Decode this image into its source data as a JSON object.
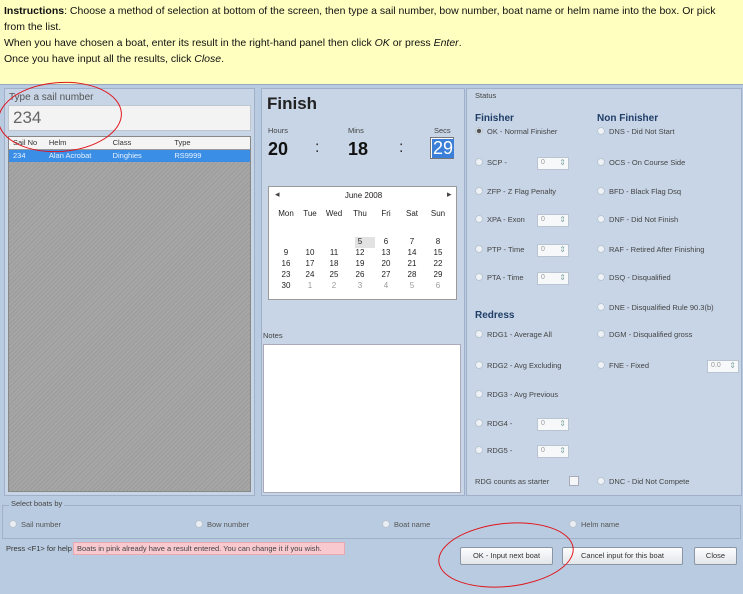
{
  "instructions": {
    "label": "Instructions",
    "line1": ": Choose a method of selection at bottom of the screen, then type a sail number, bow number, boat name or helm name into the box. Or pick from the list.",
    "line2a": "When you have chosen a boat, enter its result in the right-hand panel then click ",
    "line2_ok": "OK",
    "line2b": " or press ",
    "line2_enter": "Enter",
    "line2c": ".",
    "line3a": "Once you have input all the results, click ",
    "line3_close": "Close",
    "line3b": "."
  },
  "left": {
    "sail_label": "Type a sail number",
    "sail_value": "234",
    "grid_headers": [
      "Sail No",
      "Helm",
      "Class",
      "Type"
    ],
    "grid_row": [
      "234",
      "Alan Acrobat",
      "Dinghies",
      "RS9999"
    ]
  },
  "finish": {
    "title": "Finish",
    "hours_label": "Hours",
    "mins_label": "Mins",
    "secs_label": "Secs",
    "hours": "20",
    "mins": "18",
    "secs": "29",
    "colon": ":",
    "calendar": {
      "month": "June 2008",
      "prev": "◂",
      "next": "▸",
      "dow": [
        "Mon",
        "Tue",
        "Wed",
        "Thu",
        "Fri",
        "Sat",
        "Sun"
      ],
      "weeks": [
        [
          "",
          "",
          "",
          "5",
          "6",
          "7",
          "8"
        ],
        [
          "9",
          "10",
          "11",
          "12",
          "13",
          "14",
          "15"
        ],
        [
          "16",
          "17",
          "18",
          "19",
          "20",
          "21",
          "22"
        ],
        [
          "23",
          "24",
          "25",
          "26",
          "27",
          "28",
          "29"
        ],
        [
          "30",
          "1",
          "2",
          "3",
          "4",
          "5",
          "6"
        ]
      ]
    },
    "notes_label": "Notes"
  },
  "status": {
    "label": "Status",
    "finisher_title": "Finisher",
    "non_finisher_title": "Non Finisher",
    "redress_title": "Redress",
    "finisher": [
      "OK - Normal Finisher",
      "SCP -",
      "ZFP - Z Flag Penalty",
      "XPA - Exon",
      "PTP - Time",
      "PTA - Time"
    ],
    "spin_value": "0",
    "non_finisher": [
      "DNS - Did Not Start",
      "OCS - On Course Side",
      "BFD - Black Flag Dsq",
      "DNF - Did Not Finish",
      "RAF - Retired After Finishing",
      "DSQ - Disqualified",
      "DNE - Disqualified Rule 90.3(b)",
      "DGM - Disqualified gross",
      "FNE - Fixed"
    ],
    "fne_value": "0.0",
    "redress": [
      "RDG1 - Average All",
      "RDG2 - Avg Excluding",
      "RDG3 - Avg Previous",
      "RDG4 -",
      "RDG5 -"
    ],
    "rdg_counts": "RDG counts as starter",
    "dnc": "DNC - Did Not Compete"
  },
  "select": {
    "label": "Select boats by",
    "options": [
      "Sail number",
      "Bow number",
      "Boat name",
      "Helm name"
    ]
  },
  "bottom": {
    "help": "Press <F1> for help",
    "pink": "Boats in pink already have a result entered.  You can change it if you wish.",
    "ok_button": "OK - Input next boat",
    "cancel_button": "Cancel input for this boat",
    "close_button": "Close"
  }
}
